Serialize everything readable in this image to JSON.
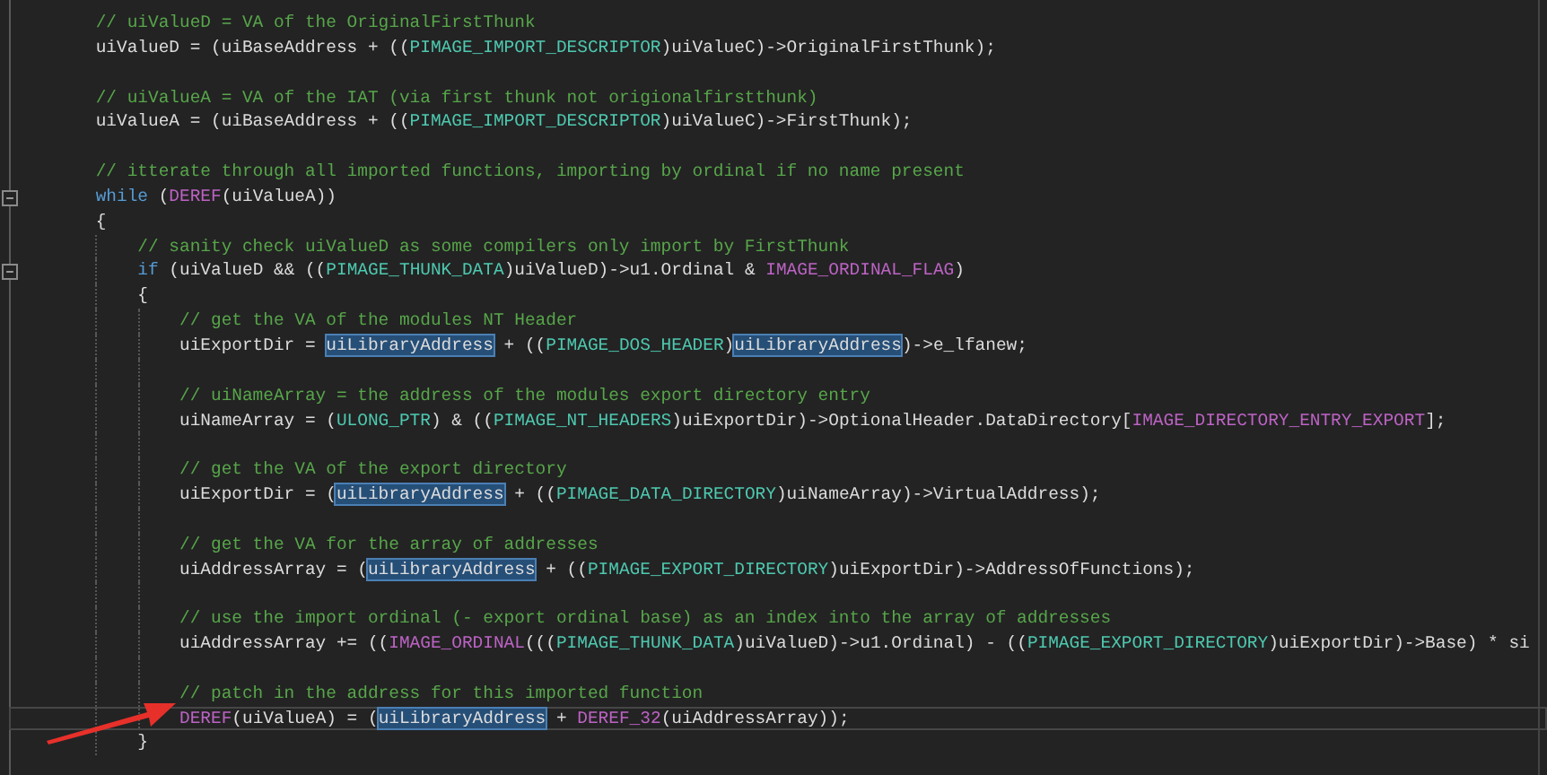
{
  "lines": [
    {
      "kind": "code",
      "fold": false,
      "current": false,
      "tokens": [
        {
          "kind": "comment",
          "text": "// uiValueD = VA of the OriginalFirstThunk"
        }
      ]
    },
    {
      "kind": "code",
      "fold": false,
      "current": false,
      "tokens": [
        {
          "kind": "plain",
          "text": "uiValueD = (uiBaseAddress + (("
        },
        {
          "kind": "type",
          "text": "PIMAGE_IMPORT_DESCRIPTOR"
        },
        {
          "kind": "plain",
          "text": ")uiValueC)->OriginalFirstThunk);"
        }
      ]
    },
    {
      "kind": "blank",
      "fold": false,
      "current": false
    },
    {
      "kind": "code",
      "fold": false,
      "current": false,
      "tokens": [
        {
          "kind": "comment",
          "text": "// uiValueA = VA of the IAT (via first thunk not origionalfirstthunk)"
        }
      ]
    },
    {
      "kind": "code",
      "fold": false,
      "current": false,
      "tokens": [
        {
          "kind": "plain",
          "text": "uiValueA = (uiBaseAddress + (("
        },
        {
          "kind": "type",
          "text": "PIMAGE_IMPORT_DESCRIPTOR"
        },
        {
          "kind": "plain",
          "text": ")uiValueC)->FirstThunk);"
        }
      ]
    },
    {
      "kind": "blank",
      "fold": false,
      "current": false
    },
    {
      "kind": "code",
      "fold": false,
      "current": false,
      "tokens": [
        {
          "kind": "comment",
          "text": "// itterate through all imported functions, importing by ordinal if no name present"
        }
      ]
    },
    {
      "kind": "code",
      "fold": true,
      "current": false,
      "tokens": [
        {
          "kind": "keyword",
          "text": "while"
        },
        {
          "kind": "plain",
          "text": " ("
        },
        {
          "kind": "macro",
          "text": "DEREF"
        },
        {
          "kind": "plain",
          "text": "(uiValueA))"
        }
      ]
    },
    {
      "kind": "code",
      "fold": false,
      "current": false,
      "tokens": [
        {
          "kind": "plain",
          "text": "{"
        }
      ],
      "children": [
        {
          "kind": "code",
          "fold": false,
          "current": false,
          "tokens": [
            {
              "kind": "comment",
              "text": "// sanity check uiValueD as some compilers only import by FirstThunk"
            }
          ]
        },
        {
          "kind": "code",
          "fold": true,
          "current": false,
          "tokens": [
            {
              "kind": "keyword",
              "text": "if"
            },
            {
              "kind": "plain",
              "text": " (uiValueD && (("
            },
            {
              "kind": "type",
              "text": "PIMAGE_THUNK_DATA"
            },
            {
              "kind": "plain",
              "text": ")uiValueD)->u1.Ordinal & "
            },
            {
              "kind": "macro",
              "text": "IMAGE_ORDINAL_FLAG"
            },
            {
              "kind": "plain",
              "text": ")"
            }
          ]
        },
        {
          "kind": "code",
          "fold": false,
          "current": false,
          "tokens": [
            {
              "kind": "plain",
              "text": "{"
            }
          ],
          "children": [
            {
              "kind": "code",
              "fold": false,
              "current": false,
              "tokens": [
                {
                  "kind": "comment",
                  "text": "// get the VA of the modules NT Header"
                }
              ]
            },
            {
              "kind": "code",
              "fold": false,
              "current": false,
              "tokens": [
                {
                  "kind": "plain",
                  "text": "uiExportDir = "
                },
                {
                  "kind": "highlight",
                  "text": "uiLibraryAddress"
                },
                {
                  "kind": "plain",
                  "text": " + (("
                },
                {
                  "kind": "type",
                  "text": "PIMAGE_DOS_HEADER"
                },
                {
                  "kind": "plain",
                  "text": ")"
                },
                {
                  "kind": "highlight",
                  "text": "uiLibraryAddress"
                },
                {
                  "kind": "plain",
                  "text": ")->e_lfanew;"
                }
              ]
            },
            {
              "kind": "blank",
              "fold": false,
              "current": false
            },
            {
              "kind": "code",
              "fold": false,
              "current": false,
              "tokens": [
                {
                  "kind": "comment",
                  "text": "// uiNameArray = the address of the modules export directory entry"
                }
              ]
            },
            {
              "kind": "code",
              "fold": false,
              "current": false,
              "tokens": [
                {
                  "kind": "plain",
                  "text": "uiNameArray = ("
                },
                {
                  "kind": "type",
                  "text": "ULONG_PTR"
                },
                {
                  "kind": "plain",
                  "text": ") & (("
                },
                {
                  "kind": "type",
                  "text": "PIMAGE_NT_HEADERS"
                },
                {
                  "kind": "plain",
                  "text": ")uiExportDir)->OptionalHeader.DataDirectory["
                },
                {
                  "kind": "macro",
                  "text": "IMAGE_DIRECTORY_ENTRY_EXPORT"
                },
                {
                  "kind": "plain",
                  "text": "];"
                }
              ]
            },
            {
              "kind": "blank",
              "fold": false,
              "current": false
            },
            {
              "kind": "code",
              "fold": false,
              "current": false,
              "tokens": [
                {
                  "kind": "comment",
                  "text": "// get the VA of the export directory"
                }
              ]
            },
            {
              "kind": "code",
              "fold": false,
              "current": false,
              "tokens": [
                {
                  "kind": "plain",
                  "text": "uiExportDir = ("
                },
                {
                  "kind": "highlight",
                  "text": "uiLibraryAddress"
                },
                {
                  "kind": "plain",
                  "text": " + (("
                },
                {
                  "kind": "type",
                  "text": "PIMAGE_DATA_DIRECTORY"
                },
                {
                  "kind": "plain",
                  "text": ")uiNameArray)->VirtualAddress);"
                }
              ]
            },
            {
              "kind": "blank",
              "fold": false,
              "current": false
            },
            {
              "kind": "code",
              "fold": false,
              "current": false,
              "tokens": [
                {
                  "kind": "comment",
                  "text": "// get the VA for the array of addresses"
                }
              ]
            },
            {
              "kind": "code",
              "fold": false,
              "current": false,
              "tokens": [
                {
                  "kind": "plain",
                  "text": "uiAddressArray = ("
                },
                {
                  "kind": "highlight",
                  "text": "uiLibraryAddress"
                },
                {
                  "kind": "plain",
                  "text": " + (("
                },
                {
                  "kind": "type",
                  "text": "PIMAGE_EXPORT_DIRECTORY"
                },
                {
                  "kind": "plain",
                  "text": ")uiExportDir)->AddressOfFunctions);"
                }
              ]
            },
            {
              "kind": "blank",
              "fold": false,
              "current": false
            },
            {
              "kind": "code",
              "fold": false,
              "current": false,
              "tokens": [
                {
                  "kind": "comment",
                  "text": "// use the import ordinal (- export ordinal base) as an index into the array of addresses"
                }
              ]
            },
            {
              "kind": "code",
              "fold": false,
              "current": false,
              "tokens": [
                {
                  "kind": "plain",
                  "text": "uiAddressArray += (("
                },
                {
                  "kind": "macro",
                  "text": "IMAGE_ORDINAL"
                },
                {
                  "kind": "plain",
                  "text": "((("
                },
                {
                  "kind": "type",
                  "text": "PIMAGE_THUNK_DATA"
                },
                {
                  "kind": "plain",
                  "text": ")uiValueD)->u1.Ordinal) - (("
                },
                {
                  "kind": "type",
                  "text": "PIMAGE_EXPORT_DIRECTORY"
                },
                {
                  "kind": "plain",
                  "text": ")uiExportDir)->Base) * si"
                }
              ]
            },
            {
              "kind": "blank",
              "fold": false,
              "current": false
            },
            {
              "kind": "code",
              "fold": false,
              "current": false,
              "tokens": [
                {
                  "kind": "comment",
                  "text": "// patch in the address for this imported function"
                }
              ]
            },
            {
              "kind": "code",
              "fold": false,
              "current": true,
              "tokens": [
                {
                  "kind": "macro",
                  "text": "DEREF"
                },
                {
                  "kind": "plain",
                  "text": "(uiValueA) = ("
                },
                {
                  "kind": "highlight",
                  "text": "uiLibraryAddress"
                },
                {
                  "kind": "plain",
                  "text": " + "
                },
                {
                  "kind": "macro",
                  "text": "DEREF_32"
                },
                {
                  "kind": "plain",
                  "text": "(uiAddressArray));"
                }
              ]
            }
          ]
        },
        {
          "kind": "code",
          "fold": false,
          "current": false,
          "tokens": [
            {
              "kind": "plain",
              "text": "}"
            }
          ]
        }
      ]
    }
  ]
}
